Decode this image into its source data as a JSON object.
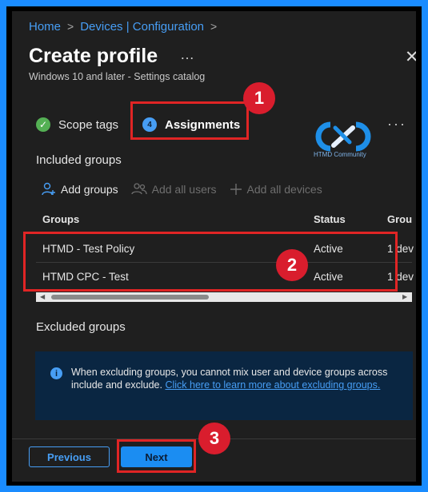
{
  "breadcrumb": {
    "home": "Home",
    "devices": "Devices | Configuration",
    "sep": ">"
  },
  "header": {
    "title": "Create profile",
    "more": "…",
    "close": "✕",
    "subtitle": "Windows 10 and later - Settings catalog"
  },
  "steps": {
    "scope": {
      "label": "Scope tags",
      "icon": "✓"
    },
    "assignments": {
      "label": "Assignments",
      "number": "4"
    }
  },
  "logo": {
    "text": "HTMD Community"
  },
  "more_menu": "···",
  "included": {
    "label": "Included groups",
    "actions": {
      "add_groups": "Add groups",
      "add_all_users": "Add all users",
      "add_all_devices": "Add all devices"
    }
  },
  "table": {
    "headers": {
      "groups": "Groups",
      "status": "Status",
      "group_cut": "Grou"
    },
    "rows": [
      {
        "group": "HTMD - Test Policy",
        "status": "Active",
        "members": "1 dev"
      },
      {
        "group": "HTMD CPC - Test",
        "status": "Active",
        "members": "1 dev"
      }
    ]
  },
  "excluded": {
    "label": "Excluded groups",
    "info_text": "When excluding groups, you cannot mix user and device groups across include and exclude. ",
    "info_link": "Click here to learn more about excluding groups.",
    "info_icon": "i"
  },
  "footer": {
    "previous": "Previous",
    "next": "Next"
  },
  "callouts": {
    "one": "1",
    "two": "2",
    "three": "3"
  },
  "colors": {
    "accent": "#479ef5",
    "callout": "#e02525",
    "badge": "#d91d2d",
    "frame": "#1a8cff"
  }
}
